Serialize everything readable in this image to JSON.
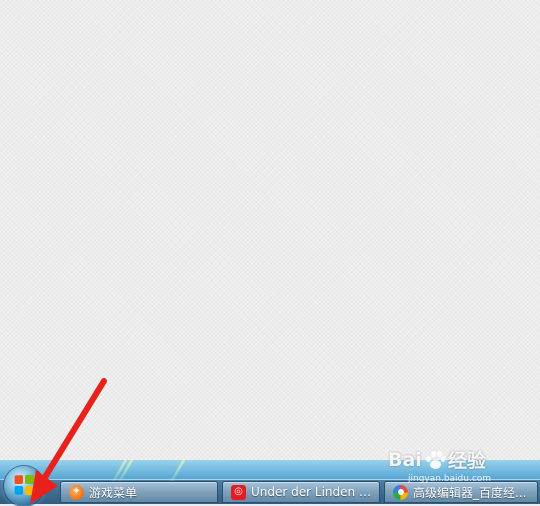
{
  "taskbar": {
    "items": [
      {
        "label": "游戏菜单",
        "icon": "game-menu-icon"
      },
      {
        "label": "Under der Linden -...",
        "icon": "netease-music-icon"
      },
      {
        "label": "高级编辑器_百度经...",
        "icon": "baidu-browser-icon"
      }
    ]
  },
  "start_button": {
    "icon": "windows-logo-icon"
  },
  "watermark": {
    "brand_latin": "Bai",
    "brand_cn": "经验",
    "url": "jingyan.baidu.com"
  },
  "annotation": {
    "icon": "red-arrow-icon",
    "color": "#e8211a"
  },
  "colors": {
    "desktop_bg": "#ececec",
    "taskbar_top": "#5aa9d6",
    "taskbar_bottom": "#2f5c80",
    "arrow_red": "#e8211a"
  }
}
